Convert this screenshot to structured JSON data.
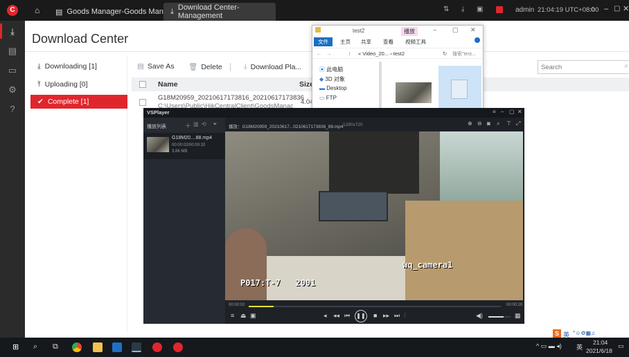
{
  "titlebar": {
    "tab1": "Goods Manager-Goods Manager",
    "tab2": "Download Center-Management",
    "user": "admin",
    "clock": "21:04:19 UTC+08:00"
  },
  "page": {
    "title": "Download Center"
  },
  "sidenav": {
    "items": [
      {
        "label": "Downloading [1]"
      },
      {
        "label": "Uploading [0]"
      },
      {
        "label": "Complete [1]"
      }
    ]
  },
  "toolbar": {
    "save_as": "Save As",
    "delete": "Delete",
    "download_player": "Download Pla...",
    "search_placeholder": "Search"
  },
  "table": {
    "headers": [
      "Name",
      "Size"
    ],
    "rows": [
      {
        "name": "G18M20959_20210617173816_20210617173836",
        "path": "C:\\Users\\Public\\HikCentralClient\\GoodsManager\\Vi...",
        "size": "4.04"
      }
    ]
  },
  "explorer": {
    "title": "test2",
    "play_tab": "播放",
    "ribbon": [
      "文件",
      "主页",
      "共享",
      "查看",
      "视频工具"
    ],
    "address": "« Video_20... › test2",
    "search_placeholder": "搜索\"test...",
    "tree": [
      "此电脑",
      "3D 对象",
      "Desktop",
      "FTP"
    ]
  },
  "player": {
    "app": "VSPlayer",
    "playlist_title": "播放列表",
    "file_title": "播放：G18M20959_20210617...0210617173836_88.mp4",
    "file_res": "1280x720",
    "item_name": "G18M20....88.mp4",
    "item_duration": "00:00:02/00:00:20",
    "item_size": "3.86 MB",
    "time_current": "00:00:02",
    "time_total": "00:00:20",
    "progress": 0.1,
    "volume": 0.7,
    "overlay_camera": "wq_camera1",
    "overlay_code": "P017:T-7   2001"
  },
  "taskbar": {
    "time": "21:04",
    "date": "2021/6/18",
    "ime": "英"
  },
  "colors": {
    "accent": "#e0262d",
    "player_bg": "#1e2227"
  }
}
